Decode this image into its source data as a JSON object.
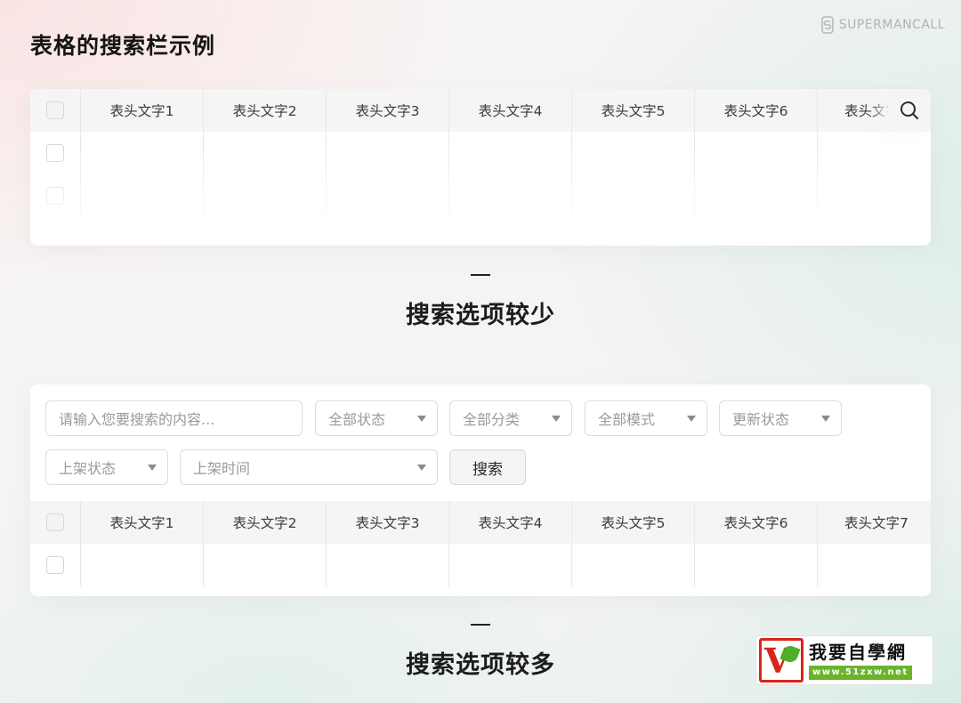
{
  "page": {
    "title": "表格的搜索栏示例"
  },
  "brand": {
    "name": "SUPERMANCALL"
  },
  "example1": {
    "headers": [
      "表头文字1",
      "表头文字2",
      "表头文字3",
      "表头文字4",
      "表头文字5",
      "表头文字6",
      "表头文字"
    ],
    "caption": "搜索选项较少"
  },
  "example2": {
    "search_placeholder": "请输入您要搜索的内容...",
    "selects": [
      "全部状态",
      "全部分类",
      "全部模式",
      "更新状态",
      "上架状态",
      "上架时间"
    ],
    "search_button": "搜索",
    "headers": [
      "表头文字1",
      "表头文字2",
      "表头文字3",
      "表头文字4",
      "表头文字5",
      "表头文字6",
      "表头文字7"
    ],
    "caption": "搜索选项较多"
  },
  "watermark": {
    "name": "我要自學網",
    "url": "www.51zxw.net"
  },
  "icons": {
    "search": "search-icon",
    "brand": "brand-logo-icon",
    "select_caret": "caret-down-icon"
  },
  "colors": {
    "table_header_bg": "#f5f5f5",
    "border": "#dcdcdc",
    "card_bg": "#ffffff"
  }
}
